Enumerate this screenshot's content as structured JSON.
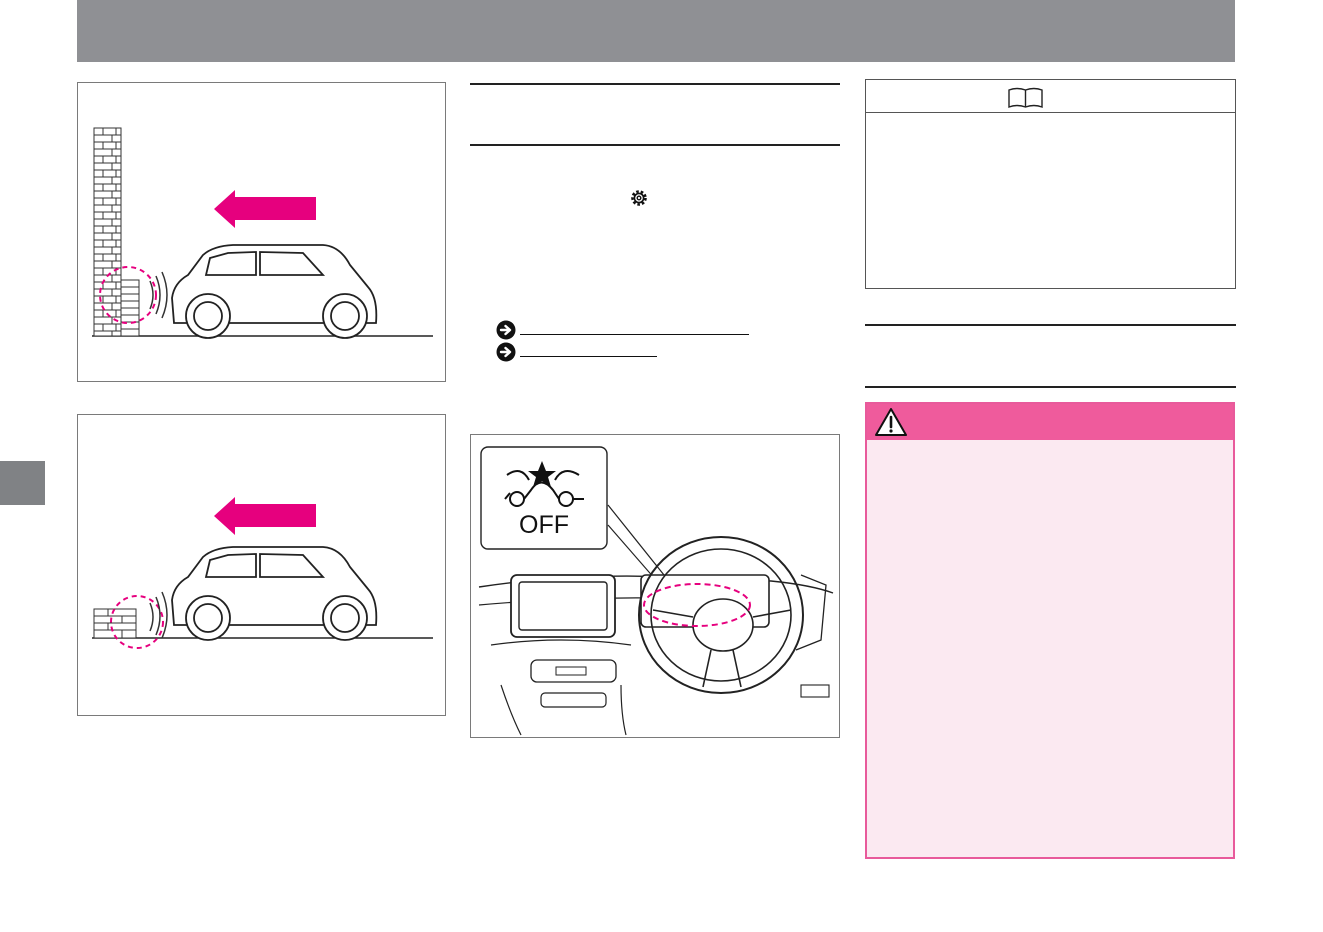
{
  "colors": {
    "header": "#8f9094",
    "side_tab": "#808285",
    "accent_magenta": "#e6007e",
    "warning_header": "#ef5b9c",
    "warning_bg": "#fbe9f1",
    "warning_border": "#e85a9b"
  },
  "icons": {
    "settings": "gear-icon",
    "reference": "book-icon",
    "warning": "warning-triangle-icon",
    "link": "arrow-right-circle-icon"
  },
  "figures": {
    "indicator_label": "OFF"
  }
}
